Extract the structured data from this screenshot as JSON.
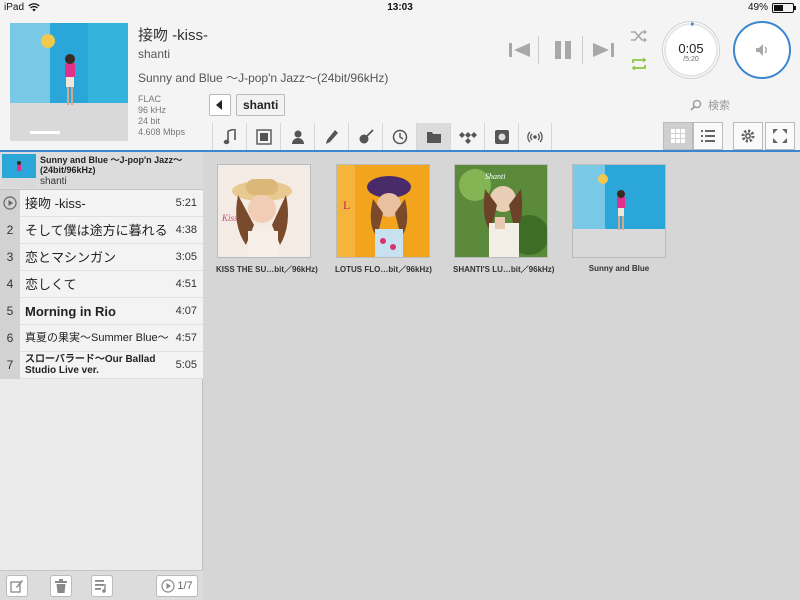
{
  "status": {
    "device": "iPad",
    "time": "13:03",
    "battery": "49%",
    "battery_level": 0.49
  },
  "now_playing": {
    "title": "接吻 -kiss-",
    "artist": "shanti",
    "album": "Sunny and Blue 〜J-pop'n Jazz〜(24bit/96kHz)",
    "format": [
      "FLAC",
      "96 kHz",
      "24 bit",
      "4.608 Mbps"
    ],
    "elapsed": "0:05",
    "total": "/5:20",
    "progress": 0.016
  },
  "browser": {
    "breadcrumb": "shanti",
    "search_placeholder": "検索",
    "source_tabs": [
      {
        "name": "music-note-icon"
      },
      {
        "name": "album-icon"
      },
      {
        "name": "artist-icon"
      },
      {
        "name": "composer-icon"
      },
      {
        "name": "genre-icon"
      },
      {
        "name": "recent-icon"
      },
      {
        "name": "folder-icon"
      },
      {
        "name": "tidal-icon"
      },
      {
        "name": "disc-icon"
      },
      {
        "name": "radio-icon"
      }
    ],
    "active_tab": 6,
    "albums": [
      {
        "label": "KISS THE SU…bit／96kHz)"
      },
      {
        "label": "LOTUS FLO…bit／96kHz)"
      },
      {
        "label": "SHANTI'S LU…bit／96kHz)"
      },
      {
        "label": "Sunny and Blue"
      }
    ]
  },
  "playlist": {
    "album": "Sunny and Blue 〜J-pop'n Jazz〜(24bit/96kHz)",
    "artist": "shanti",
    "tracks": [
      {
        "num": "",
        "title": "接吻 -kiss-",
        "duration": "5:21",
        "playing": true
      },
      {
        "num": "2",
        "title": "そして僕は途方に暮れる",
        "duration": "4:38"
      },
      {
        "num": "3",
        "title": "恋とマシンガン",
        "duration": "3:05"
      },
      {
        "num": "4",
        "title": "恋しくて",
        "duration": "4:51"
      },
      {
        "num": "5",
        "title": "Morning in Rio",
        "duration": "4:07"
      },
      {
        "num": "6",
        "title": "真夏の果実〜Summer Blue〜",
        "duration": "4:57"
      },
      {
        "num": "7",
        "title": "スローバラード〜Our Ballad Studio Live ver.",
        "duration": "5:05"
      }
    ],
    "page_indicator": "1/7"
  },
  "colors": {
    "accent": "#3a86cf",
    "shuffle_active": "#8cc63f"
  }
}
